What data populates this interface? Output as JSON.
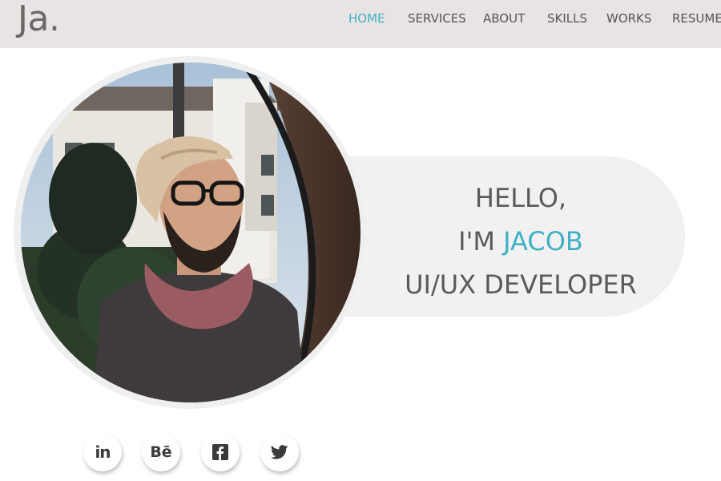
{
  "brand": {
    "logo": "Ja."
  },
  "nav": {
    "items": [
      {
        "label": "HOME",
        "active": true
      },
      {
        "label": "SERVICES",
        "active": false
      },
      {
        "label": "ABOUT",
        "active": false
      },
      {
        "label": "SKILLS",
        "active": false
      },
      {
        "label": "WORKS",
        "active": false
      },
      {
        "label": "RESUME",
        "active": false
      }
    ]
  },
  "hero": {
    "line1": "HELLO,",
    "line2_prefix": "I'M",
    "line2_name": "JACOB",
    "line3": "UI/UX DEVELOPER"
  },
  "social": [
    {
      "icon": "linkedin-icon",
      "text": "in"
    },
    {
      "icon": "behance-icon",
      "text": "Bē"
    },
    {
      "icon": "facebook-icon",
      "text": "f"
    },
    {
      "icon": "twitter-icon",
      "text": ""
    }
  ],
  "colors": {
    "accent": "#3fb0c6",
    "header_bg": "#e8e4e3",
    "text": "#5a5a5a"
  }
}
